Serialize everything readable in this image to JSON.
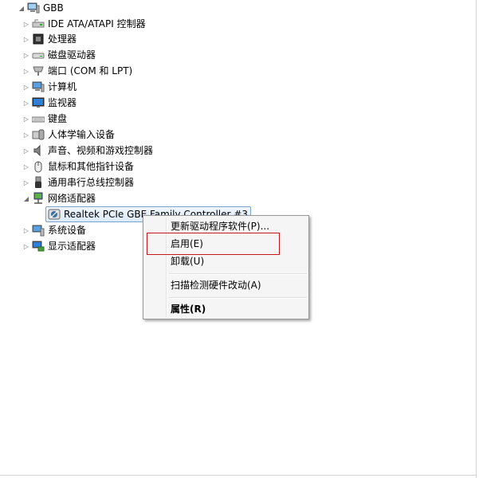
{
  "tree": {
    "root": {
      "label": "GBB",
      "icon": "computer-icon"
    },
    "items": [
      {
        "label": "IDE ATA/ATAPI 控制器",
        "icon": "ide-controller-icon"
      },
      {
        "label": "处理器",
        "icon": "processor-icon"
      },
      {
        "label": "磁盘驱动器",
        "icon": "disk-drive-icon"
      },
      {
        "label": "端口 (COM 和 LPT)",
        "icon": "port-icon"
      },
      {
        "label": "计算机",
        "icon": "computer-icon"
      },
      {
        "label": "监视器",
        "icon": "monitor-icon"
      },
      {
        "label": "键盘",
        "icon": "keyboard-icon"
      },
      {
        "label": "人体学输入设备",
        "icon": "hid-icon"
      },
      {
        "label": "声音、视频和游戏控制器",
        "icon": "speaker-icon"
      },
      {
        "label": "鼠标和其他指针设备",
        "icon": "mouse-icon"
      },
      {
        "label": "通用串行总线控制器",
        "icon": "usb-icon"
      },
      {
        "label": "网络适配器",
        "icon": "network-adapter-icon"
      }
    ],
    "network_child": {
      "label": "Realtek PCIe GBE Family Controller #3",
      "icon": "network-card-icon"
    },
    "after_items": [
      {
        "label": "系统设备",
        "icon": "system-device-icon"
      },
      {
        "label": "显示适配器",
        "icon": "display-adapter-icon"
      }
    ]
  },
  "context_menu": {
    "update_driver": "更新驱动程序软件(P)...",
    "enable": "启用(E)",
    "uninstall": "卸载(U)",
    "scan_hardware": "扫描检测硬件改动(A)",
    "properties": "属性(R)"
  },
  "colors": {
    "highlight_box": "#c8161d",
    "selection_border": "#7da2ce",
    "menu_background": "#f5f5f5"
  }
}
